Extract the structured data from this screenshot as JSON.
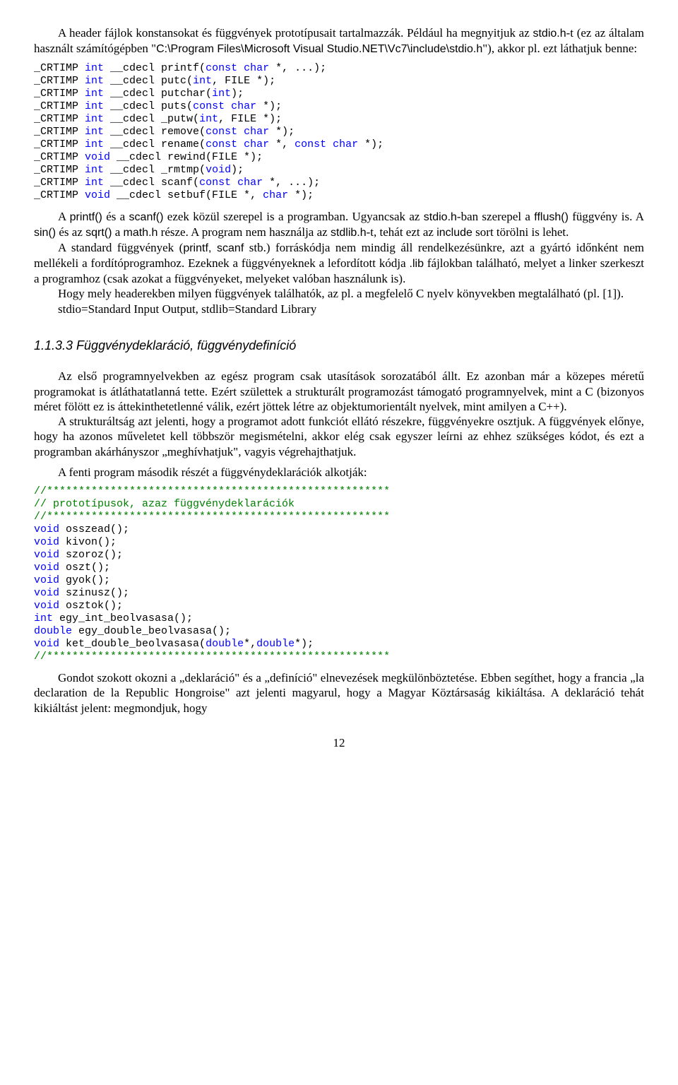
{
  "p1a": "A header fájlok konstansokat és függvények prototípusait tartalmazzák. Például ha megnyitjuk az ",
  "p1_sans1": "stdio.h",
  "p1b": "-t (ez az általam használt számítógépben \"",
  "p1_sans2": "C:\\Program Files\\Microsoft Visual Studio.NET\\Vc7\\include\\stdio.h",
  "p1c": "\"), akkor pl. ezt láthatjuk benne:",
  "code1": "_CRTIMP int __cdecl printf(const char *, ...);\n_CRTIMP int __cdecl putc(int, FILE *);\n_CRTIMP int __cdecl putchar(int);\n_CRTIMP int __cdecl puts(const char *);\n_CRTIMP int __cdecl _putw(int, FILE *);\n_CRTIMP int __cdecl remove(const char *);\n_CRTIMP int __cdecl rename(const char *, const char *);\n_CRTIMP void __cdecl rewind(FILE *);\n_CRTIMP int __cdecl _rmtmp(void);\n_CRTIMP int __cdecl scanf(const char *, ...);\n_CRTIMP void __cdecl setbuf(FILE *, char *);",
  "p2a": "A ",
  "p2_s1": "printf()",
  "p2b": " és a ",
  "p2_s2": "scanf()",
  "p2c": " ezek közül szerepel is a programban. Ugyancsak az ",
  "p2_s3": "stdio.h",
  "p2d": "-ban szerepel a ",
  "p2_s4": "fflush()",
  "p2e": " függvény is. A ",
  "p2_s5": "sin()",
  "p2f": " és az ",
  "p2_s6": "sqrt()",
  "p2g": " a ",
  "p2_s7": "math.h",
  "p2h": " része. A program nem használja az ",
  "p2_s8": "stdlib.h",
  "p2i": "-t, tehát ezt az ",
  "p2_s9": "include",
  "p2j": " sort törölni is lehet.",
  "p3a": "A standard függvények (",
  "p3_s1": "printf, scanf",
  "p3b": " stb.) forráskódja nem mindig áll rendelkezésünkre, azt a gyártó időnként nem mellékeli a fordítóprogramhoz. Ezeknek a  függvényeknek  a lefordított kódja ",
  "p3_s2": ".lib",
  "p3c": " fájlokban található, melyet a linker szerkeszt a programhoz (csak azokat a függvényeket, melyeket valóban használunk is).",
  "p4": "Hogy mely headerekben milyen függvények találhatók, az pl. a megfelelő C nyelv könyvekben megtalálható (pl. [1]).",
  "p5": "stdio=Standard Input Output, stdlib=Standard Library",
  "hdr": "1.1.3.3 Függvénydeklaráció, függvénydefiníció",
  "p6": "Az első programnyelvekben az egész program csak utasítások sorozatából állt. Ez azonban már a közepes méretű programokat is átláthatatlanná tette. Ezért születtek a strukturált programozást  támogató  programnyelvek,  mint  a  C  (bizonyos  méret  fölött  ez  is áttekinthetetlenné válik, ezért jöttek létre az objektumorientált nyelvek, mint amilyen a C++).",
  "p7": "A strukturáltság azt jelenti, hogy a programot adott funkciót ellátó részekre, függvényekre osztjuk. A függvények előnye, hogy ha azonos műveletet kell többször megismételni, akkor elég csak egyszer leírni az ehhez szükséges kódot, és ezt a programban akárhányszor „meghívhatjuk\", vagyis végrehajthatjuk.",
  "p8": "A fenti program második részét a függvénydeklarációk alkotják:",
  "code2_tokens": [
    {
      "t": "//******************************************************",
      "c": "kw-green"
    },
    {
      "t": "\n"
    },
    {
      "t": "// prototípusok, azaz függvénydeklarációk",
      "c": "kw-green"
    },
    {
      "t": "\n"
    },
    {
      "t": "//******************************************************",
      "c": "kw-green"
    },
    {
      "t": "\n"
    },
    {
      "t": "void",
      "c": "kw-blue"
    },
    {
      "t": " osszead();\n"
    },
    {
      "t": "void",
      "c": "kw-blue"
    },
    {
      "t": " kivon();\n"
    },
    {
      "t": "void",
      "c": "kw-blue"
    },
    {
      "t": " szoroz();\n"
    },
    {
      "t": "void",
      "c": "kw-blue"
    },
    {
      "t": " oszt();\n"
    },
    {
      "t": "void",
      "c": "kw-blue"
    },
    {
      "t": " gyok();\n"
    },
    {
      "t": "void",
      "c": "kw-blue"
    },
    {
      "t": " szinusz();\n"
    },
    {
      "t": "void",
      "c": "kw-blue"
    },
    {
      "t": " osztok();\n"
    },
    {
      "t": "int",
      "c": "kw-blue"
    },
    {
      "t": " egy_int_beolvasasa();\n"
    },
    {
      "t": "double",
      "c": "kw-blue"
    },
    {
      "t": " egy_double_beolvasasa();\n"
    },
    {
      "t": "void",
      "c": "kw-blue"
    },
    {
      "t": " ket_double_beolvasasa("
    },
    {
      "t": "double",
      "c": "kw-blue"
    },
    {
      "t": "*,"
    },
    {
      "t": "double",
      "c": "kw-blue"
    },
    {
      "t": "*);\n"
    },
    {
      "t": "//******************************************************",
      "c": "kw-green"
    }
  ],
  "p9": "Gondot szokott okozni a „deklaráció\" és a „definíció\" elnevezések megkülönböztetése. Ebben segíthet, hogy a francia „la declaration de la Republic Hongroise\" azt jelenti magyarul, hogy a Magyar Köztársaság kikiáltása. A deklaráció tehát kikiáltást jelent: megmondjuk, hogy",
  "pagenum": "12"
}
